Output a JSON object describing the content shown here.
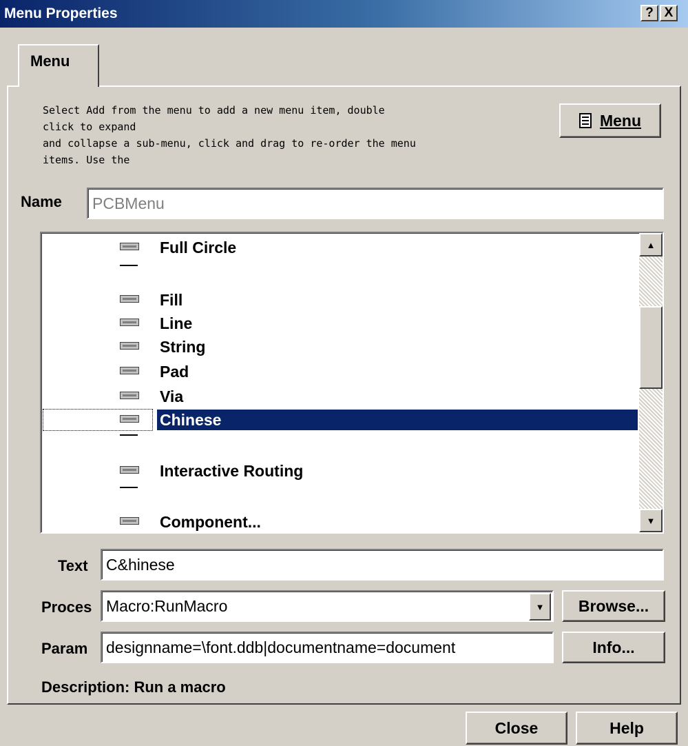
{
  "window": {
    "title": "Menu Properties",
    "help_button": "?",
    "close_button": "X"
  },
  "tab": {
    "label": "Menu"
  },
  "instructions": [
    "Select Add from the menu to add a new menu item, double",
    "click to expand",
    "and collapse a sub-menu, click and drag to re-order the menu",
    "items. Use the"
  ],
  "menu_button": {
    "label": "Menu",
    "icon": "menu-icon"
  },
  "name_field": {
    "label": "Name",
    "value": "PCBMenu"
  },
  "tree": {
    "items": [
      {
        "type": "item",
        "label": "Full Circle"
      },
      {
        "type": "separator"
      },
      {
        "type": "item",
        "label": "Fill"
      },
      {
        "type": "item",
        "label": "Line"
      },
      {
        "type": "item",
        "label": "String"
      },
      {
        "type": "item",
        "label": "Pad"
      },
      {
        "type": "item",
        "label": "Via"
      },
      {
        "type": "item",
        "label": "Chinese",
        "selected": true
      },
      {
        "type": "separator"
      },
      {
        "type": "item",
        "label": "Interactive Routing"
      },
      {
        "type": "separator"
      },
      {
        "type": "item",
        "label": "Component..."
      }
    ]
  },
  "text_field": {
    "label": "Text",
    "value": "C&hinese"
  },
  "process_field": {
    "label": "Proces",
    "value": "Macro:RunMacro",
    "browse_label": "Browse..."
  },
  "params_field": {
    "label": "Param",
    "value": "designname=\\font.ddb|documentname=document",
    "info_label": "Info..."
  },
  "description": "Description: Run a macro",
  "footer": {
    "close_label": "Close",
    "help_label": "Help"
  }
}
